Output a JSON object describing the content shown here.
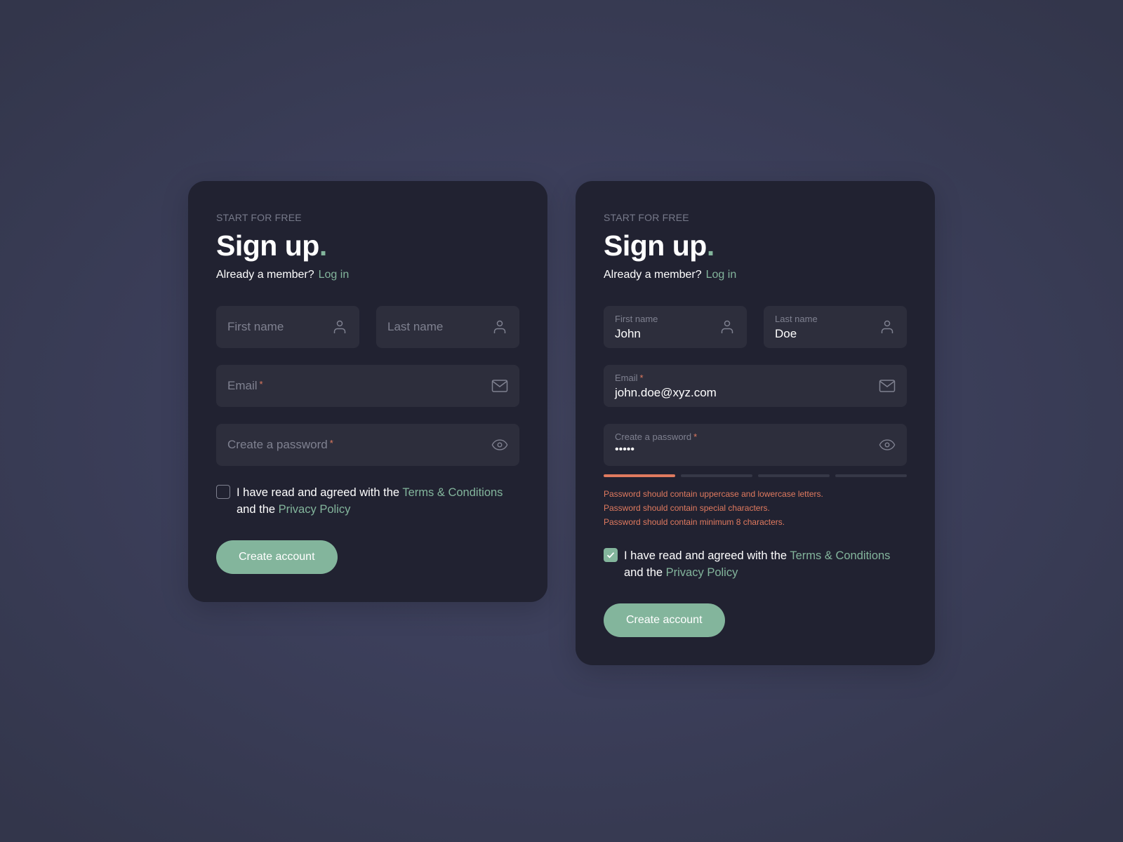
{
  "colors": {
    "accent": "#83b59c",
    "error": "#e07a5f",
    "card_bg": "#212231",
    "field_bg": "#2d2e3c"
  },
  "cards": [
    {
      "state": "empty",
      "eyebrow": "START FOR FREE",
      "title": "Sign up",
      "title_dot": ".",
      "member_prompt": "Already a member?",
      "login_link": "Log in",
      "first_name": {
        "placeholder": "First name",
        "value": "",
        "icon": "user-icon"
      },
      "last_name": {
        "placeholder": "Last name",
        "value": "",
        "icon": "user-icon"
      },
      "email": {
        "placeholder": "Email",
        "required_mark": "*",
        "value": "",
        "icon": "mail-icon"
      },
      "password": {
        "placeholder": "Create a password",
        "required_mark": "*",
        "value": "",
        "icon": "eye-icon"
      },
      "agree": {
        "checked": false,
        "text_before": "I have read and agreed with the ",
        "terms_link": "Terms & Conditions",
        "text_middle": " and the ",
        "privacy_link": "Privacy Policy"
      },
      "submit_label": "Create account"
    },
    {
      "state": "filled",
      "eyebrow": "START FOR FREE",
      "title": "Sign up",
      "title_dot": ".",
      "member_prompt": "Already a member?",
      "login_link": "Log in",
      "first_name": {
        "label": "First name",
        "value": "John",
        "icon": "user-icon"
      },
      "last_name": {
        "label": "Last name",
        "value": "Doe",
        "icon": "user-icon"
      },
      "email": {
        "label": "Email",
        "required_mark": "*",
        "value": "john.doe@xyz.com",
        "icon": "mail-icon"
      },
      "password": {
        "label": "Create a password",
        "required_mark": "*",
        "value": "•••••",
        "icon": "eye-icon"
      },
      "password_strength": {
        "filled_segments": 1,
        "total_segments": 4
      },
      "password_errors": [
        "Password should contain uppercase and lowercase letters.",
        "Password should contain special characters.",
        "Password should contain minimum 8 characters."
      ],
      "agree": {
        "checked": true,
        "text_before": "I have read and agreed with the ",
        "terms_link": "Terms & Conditions",
        "text_middle": " and the ",
        "privacy_link": "Privacy Policy"
      },
      "submit_label": "Create account"
    }
  ]
}
